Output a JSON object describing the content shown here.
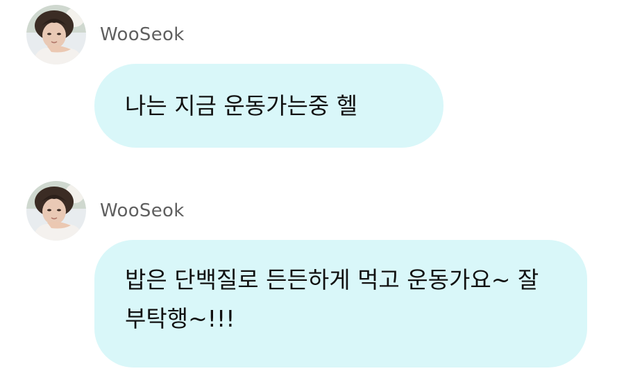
{
  "messages": [
    {
      "sender": "WooSeok",
      "text": "나는 지금 운동가는중 헬"
    },
    {
      "sender": "WooSeok",
      "text": "밥은 단백질로 든든하게 먹고 운동가요~ 잘 부탁행~!!!"
    }
  ],
  "colors": {
    "bubble_background": "#d9f7f9",
    "sender_text": "#5f5f5f",
    "message_text": "#111111"
  }
}
